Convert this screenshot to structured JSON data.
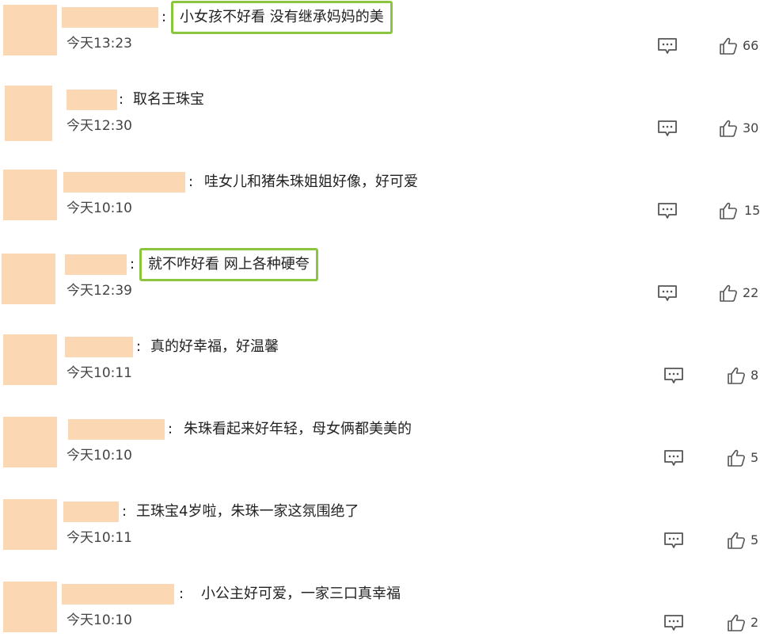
{
  "comments": [
    {
      "text": "小女孩不好看 没有继承妈妈的美",
      "time": "今天13:23",
      "likes": "66",
      "highlighted": true
    },
    {
      "text": "取名王珠宝",
      "time": "今天12:30",
      "likes": "30",
      "highlighted": false
    },
    {
      "text": "哇女儿和猪朱珠姐姐好像，好可爱",
      "time": "今天10:10",
      "likes": "15",
      "highlighted": false
    },
    {
      "text": "就不咋好看 网上各种硬夸",
      "time": "今天12:39",
      "likes": "22",
      "highlighted": true
    },
    {
      "text": "真的好幸福，好温馨",
      "time": "今天10:11",
      "likes": "8",
      "highlighted": false
    },
    {
      "text": "朱珠看起来好年轻，母女俩都美美的",
      "time": "今天10:10",
      "likes": "5",
      "highlighted": false
    },
    {
      "text": "王珠宝4岁啦，朱珠一家这氛围绝了",
      "time": "今天10:11",
      "likes": "5",
      "highlighted": false
    },
    {
      "text": "小公主好可爱，一家三口真幸福",
      "time": "今天10:10",
      "likes": "2",
      "highlighted": false
    }
  ],
  "icons": {
    "reply": "comment-bubble-icon",
    "like": "thumbs-up-icon"
  },
  "colors": {
    "highlight_border": "#8cc63f",
    "redaction": "#fcd7b4"
  }
}
